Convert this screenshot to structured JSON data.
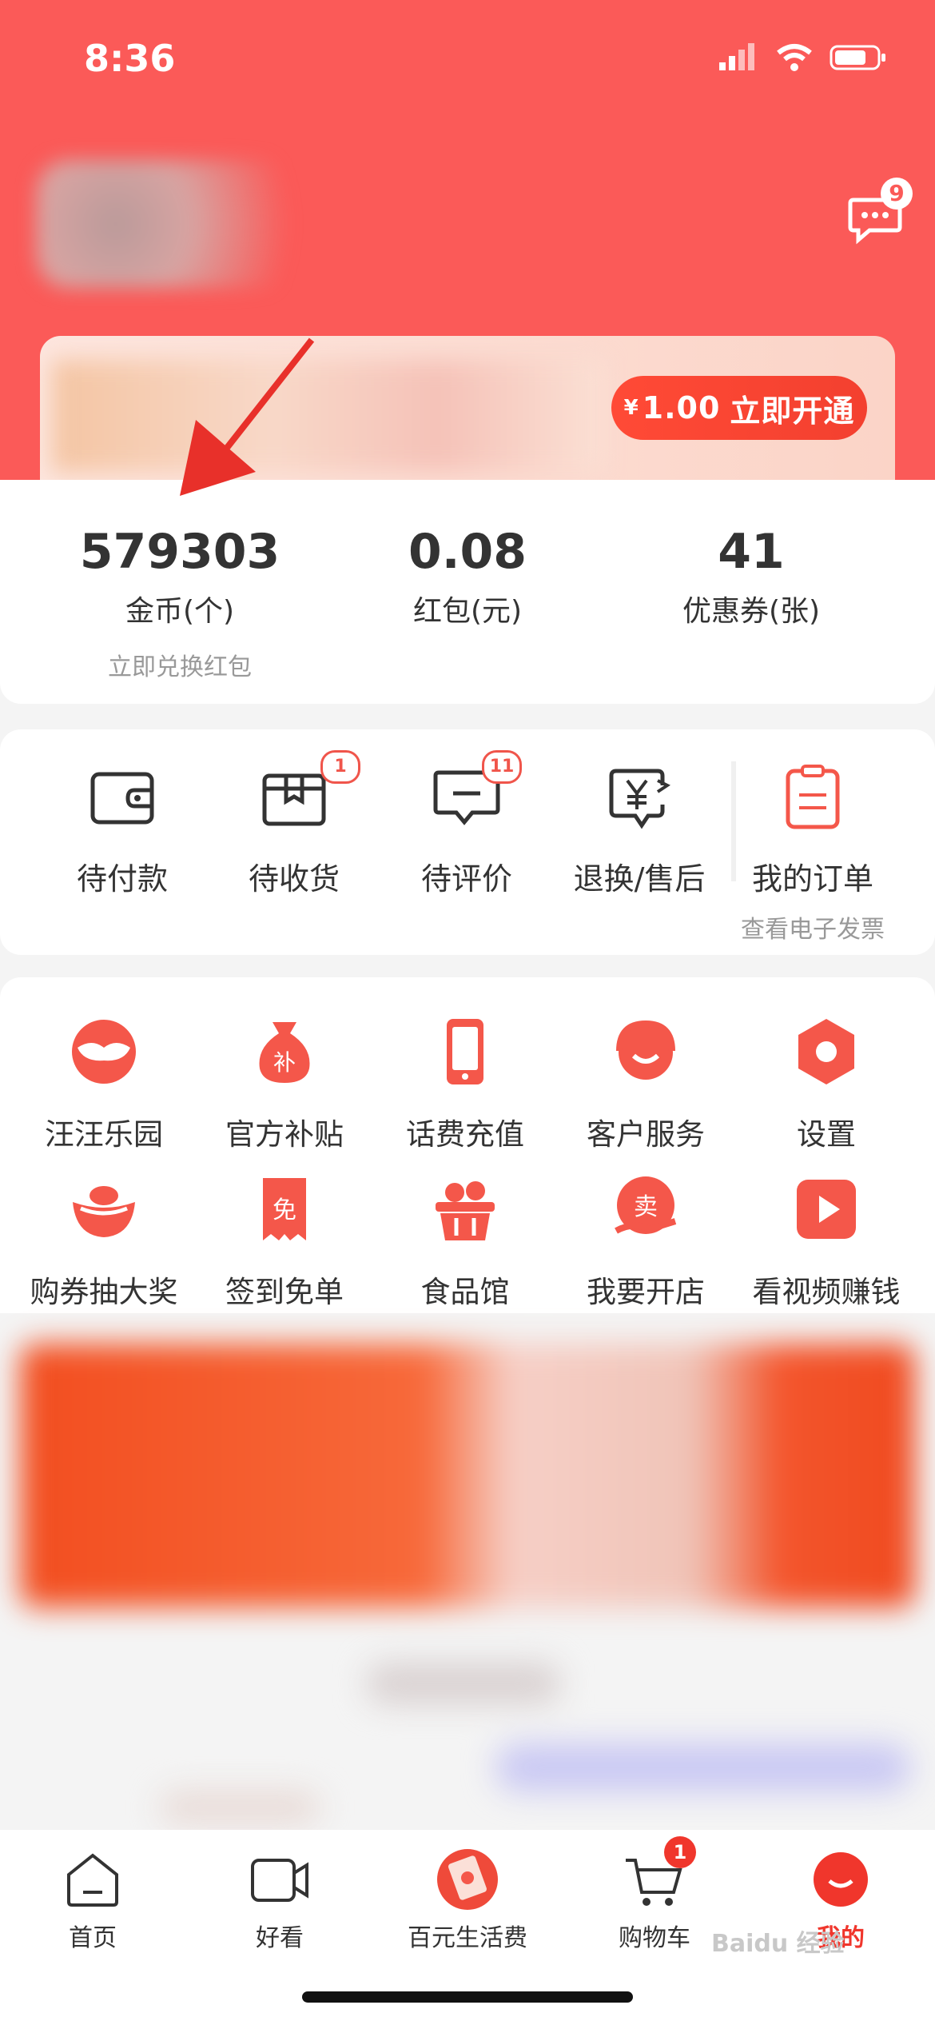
{
  "status_bar": {
    "time": "8:36"
  },
  "header": {
    "message_badge": "9"
  },
  "vip": {
    "price_symbol": "¥",
    "price": "1.00",
    "cta": "立即开通"
  },
  "stats": [
    {
      "value": "579303",
      "label": "金币(个)",
      "sub": "立即兑换红包"
    },
    {
      "value": "0.08",
      "label": "红包(元)"
    },
    {
      "value": "41",
      "label": "优惠券(张)"
    }
  ],
  "orders": [
    {
      "label": "待付款",
      "icon": "wallet-icon"
    },
    {
      "label": "待收货",
      "icon": "package-icon",
      "badge": "1"
    },
    {
      "label": "待评价",
      "icon": "comment-icon",
      "badge": "11"
    },
    {
      "label": "退换/售后",
      "icon": "refund-icon"
    },
    {
      "label": "我的订单",
      "icon": "order-list-icon",
      "sub": "查看电子发票"
    }
  ],
  "services": [
    {
      "label": "汪汪乐园",
      "icon": "dog-icon"
    },
    {
      "label": "官方补贴",
      "icon": "subsidy-bag-icon",
      "glyph": "补"
    },
    {
      "label": "话费充值",
      "icon": "phone-icon"
    },
    {
      "label": "客户服务",
      "icon": "headset-icon"
    },
    {
      "label": "设置",
      "icon": "settings-icon"
    },
    {
      "label": "购券抽大奖",
      "icon": "gold-ingot-icon"
    },
    {
      "label": "签到免单",
      "icon": "free-receipt-icon",
      "glyph": "免"
    },
    {
      "label": "食品馆",
      "icon": "food-basket-icon"
    },
    {
      "label": "我要开店",
      "icon": "open-shop-icon",
      "glyph": "卖"
    },
    {
      "label": "看视频赚钱",
      "icon": "video-play-icon"
    }
  ],
  "tabbar": [
    {
      "label": "首页",
      "icon": "home-icon"
    },
    {
      "label": "好看",
      "icon": "video-camera-icon"
    },
    {
      "label": "百元生活费",
      "icon": "red-envelope-icon"
    },
    {
      "label": "购物车",
      "icon": "cart-icon",
      "badge": "1"
    },
    {
      "label": "我的",
      "icon": "profile-icon",
      "active": true
    }
  ],
  "watermark": "Baidu 经验",
  "colors": {
    "brand": "#fb5a58",
    "accent": "#f0362c",
    "icon_red": "#f4574a"
  }
}
